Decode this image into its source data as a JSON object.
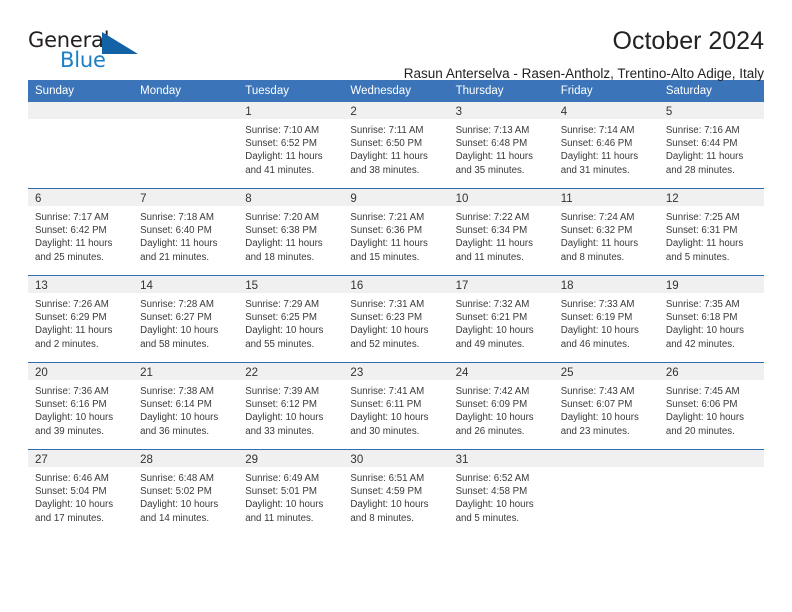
{
  "logo": {
    "word_one": "General",
    "word_two": "Blue",
    "triangle_color": "#1362a6",
    "blue_text_color": "#1c7fc4"
  },
  "header": {
    "title": "October 2024",
    "subtitle": "Rasun Anterselva - Rasen-Antholz, Trentino-Alto Adige, Italy",
    "accent_color": "#3b74b8",
    "band_color": "#f0f0f0"
  },
  "calendar": {
    "day_headers": [
      "Sunday",
      "Monday",
      "Tuesday",
      "Wednesday",
      "Thursday",
      "Friday",
      "Saturday"
    ],
    "weeks": [
      [
        {
          "day": "",
          "lines": []
        },
        {
          "day": "",
          "lines": []
        },
        {
          "day": "1",
          "lines": [
            "Sunrise: 7:10 AM",
            "Sunset: 6:52 PM",
            "Daylight: 11 hours",
            "and 41 minutes."
          ]
        },
        {
          "day": "2",
          "lines": [
            "Sunrise: 7:11 AM",
            "Sunset: 6:50 PM",
            "Daylight: 11 hours",
            "and 38 minutes."
          ]
        },
        {
          "day": "3",
          "lines": [
            "Sunrise: 7:13 AM",
            "Sunset: 6:48 PM",
            "Daylight: 11 hours",
            "and 35 minutes."
          ]
        },
        {
          "day": "4",
          "lines": [
            "Sunrise: 7:14 AM",
            "Sunset: 6:46 PM",
            "Daylight: 11 hours",
            "and 31 minutes."
          ]
        },
        {
          "day": "5",
          "lines": [
            "Sunrise: 7:16 AM",
            "Sunset: 6:44 PM",
            "Daylight: 11 hours",
            "and 28 minutes."
          ]
        }
      ],
      [
        {
          "day": "6",
          "lines": [
            "Sunrise: 7:17 AM",
            "Sunset: 6:42 PM",
            "Daylight: 11 hours",
            "and 25 minutes."
          ]
        },
        {
          "day": "7",
          "lines": [
            "Sunrise: 7:18 AM",
            "Sunset: 6:40 PM",
            "Daylight: 11 hours",
            "and 21 minutes."
          ]
        },
        {
          "day": "8",
          "lines": [
            "Sunrise: 7:20 AM",
            "Sunset: 6:38 PM",
            "Daylight: 11 hours",
            "and 18 minutes."
          ]
        },
        {
          "day": "9",
          "lines": [
            "Sunrise: 7:21 AM",
            "Sunset: 6:36 PM",
            "Daylight: 11 hours",
            "and 15 minutes."
          ]
        },
        {
          "day": "10",
          "lines": [
            "Sunrise: 7:22 AM",
            "Sunset: 6:34 PM",
            "Daylight: 11 hours",
            "and 11 minutes."
          ]
        },
        {
          "day": "11",
          "lines": [
            "Sunrise: 7:24 AM",
            "Sunset: 6:32 PM",
            "Daylight: 11 hours",
            "and 8 minutes."
          ]
        },
        {
          "day": "12",
          "lines": [
            "Sunrise: 7:25 AM",
            "Sunset: 6:31 PM",
            "Daylight: 11 hours",
            "and 5 minutes."
          ]
        }
      ],
      [
        {
          "day": "13",
          "lines": [
            "Sunrise: 7:26 AM",
            "Sunset: 6:29 PM",
            "Daylight: 11 hours",
            "and 2 minutes."
          ]
        },
        {
          "day": "14",
          "lines": [
            "Sunrise: 7:28 AM",
            "Sunset: 6:27 PM",
            "Daylight: 10 hours",
            "and 58 minutes."
          ]
        },
        {
          "day": "15",
          "lines": [
            "Sunrise: 7:29 AM",
            "Sunset: 6:25 PM",
            "Daylight: 10 hours",
            "and 55 minutes."
          ]
        },
        {
          "day": "16",
          "lines": [
            "Sunrise: 7:31 AM",
            "Sunset: 6:23 PM",
            "Daylight: 10 hours",
            "and 52 minutes."
          ]
        },
        {
          "day": "17",
          "lines": [
            "Sunrise: 7:32 AM",
            "Sunset: 6:21 PM",
            "Daylight: 10 hours",
            "and 49 minutes."
          ]
        },
        {
          "day": "18",
          "lines": [
            "Sunrise: 7:33 AM",
            "Sunset: 6:19 PM",
            "Daylight: 10 hours",
            "and 46 minutes."
          ]
        },
        {
          "day": "19",
          "lines": [
            "Sunrise: 7:35 AM",
            "Sunset: 6:18 PM",
            "Daylight: 10 hours",
            "and 42 minutes."
          ]
        }
      ],
      [
        {
          "day": "20",
          "lines": [
            "Sunrise: 7:36 AM",
            "Sunset: 6:16 PM",
            "Daylight: 10 hours",
            "and 39 minutes."
          ]
        },
        {
          "day": "21",
          "lines": [
            "Sunrise: 7:38 AM",
            "Sunset: 6:14 PM",
            "Daylight: 10 hours",
            "and 36 minutes."
          ]
        },
        {
          "day": "22",
          "lines": [
            "Sunrise: 7:39 AM",
            "Sunset: 6:12 PM",
            "Daylight: 10 hours",
            "and 33 minutes."
          ]
        },
        {
          "day": "23",
          "lines": [
            "Sunrise: 7:41 AM",
            "Sunset: 6:11 PM",
            "Daylight: 10 hours",
            "and 30 minutes."
          ]
        },
        {
          "day": "24",
          "lines": [
            "Sunrise: 7:42 AM",
            "Sunset: 6:09 PM",
            "Daylight: 10 hours",
            "and 26 minutes."
          ]
        },
        {
          "day": "25",
          "lines": [
            "Sunrise: 7:43 AM",
            "Sunset: 6:07 PM",
            "Daylight: 10 hours",
            "and 23 minutes."
          ]
        },
        {
          "day": "26",
          "lines": [
            "Sunrise: 7:45 AM",
            "Sunset: 6:06 PM",
            "Daylight: 10 hours",
            "and 20 minutes."
          ]
        }
      ],
      [
        {
          "day": "27",
          "lines": [
            "Sunrise: 6:46 AM",
            "Sunset: 5:04 PM",
            "Daylight: 10 hours",
            "and 17 minutes."
          ]
        },
        {
          "day": "28",
          "lines": [
            "Sunrise: 6:48 AM",
            "Sunset: 5:02 PM",
            "Daylight: 10 hours",
            "and 14 minutes."
          ]
        },
        {
          "day": "29",
          "lines": [
            "Sunrise: 6:49 AM",
            "Sunset: 5:01 PM",
            "Daylight: 10 hours",
            "and 11 minutes."
          ]
        },
        {
          "day": "30",
          "lines": [
            "Sunrise: 6:51 AM",
            "Sunset: 4:59 PM",
            "Daylight: 10 hours",
            "and 8 minutes."
          ]
        },
        {
          "day": "31",
          "lines": [
            "Sunrise: 6:52 AM",
            "Sunset: 4:58 PM",
            "Daylight: 10 hours",
            "and 5 minutes."
          ]
        },
        {
          "day": "",
          "lines": []
        },
        {
          "day": "",
          "lines": []
        }
      ]
    ]
  }
}
